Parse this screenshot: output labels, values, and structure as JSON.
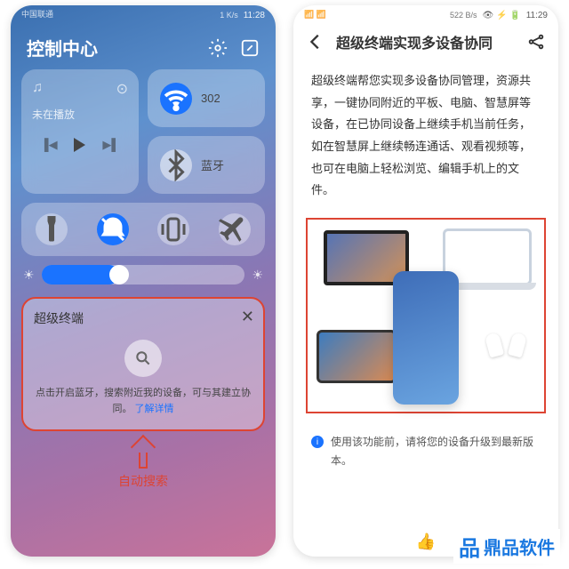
{
  "left": {
    "status": {
      "carrier": "中国联通",
      "time": "11:28",
      "speed": "1 K/s"
    },
    "title": "控制中心",
    "media": {
      "status": "未在播放"
    },
    "wifi": {
      "label": "302"
    },
    "bluetooth": {
      "label": "蓝牙"
    },
    "superDevice": {
      "title": "超级终端",
      "hint": "点击开启蓝牙，搜索附近我的设备，可与其建立协同。",
      "link": "了解详情"
    },
    "annotation": "自动搜索"
  },
  "right": {
    "status": {
      "time": "11:29",
      "speed": "522 B/s"
    },
    "title": "超级终端实现多设备协同",
    "description": "超级终端帮您实现多设备协同管理，资源共享，一键协同附近的平板、电脑、智慧屏等设备，在已协同设备上继续手机当前任务，如在智慧屏上继续畅连通话、观看视频等，也可在电脑上轻松浏览、编辑手机上的文件。",
    "note": "使用该功能前，请将您的设备升级到最新版本。"
  },
  "brand": "鼎品软件"
}
